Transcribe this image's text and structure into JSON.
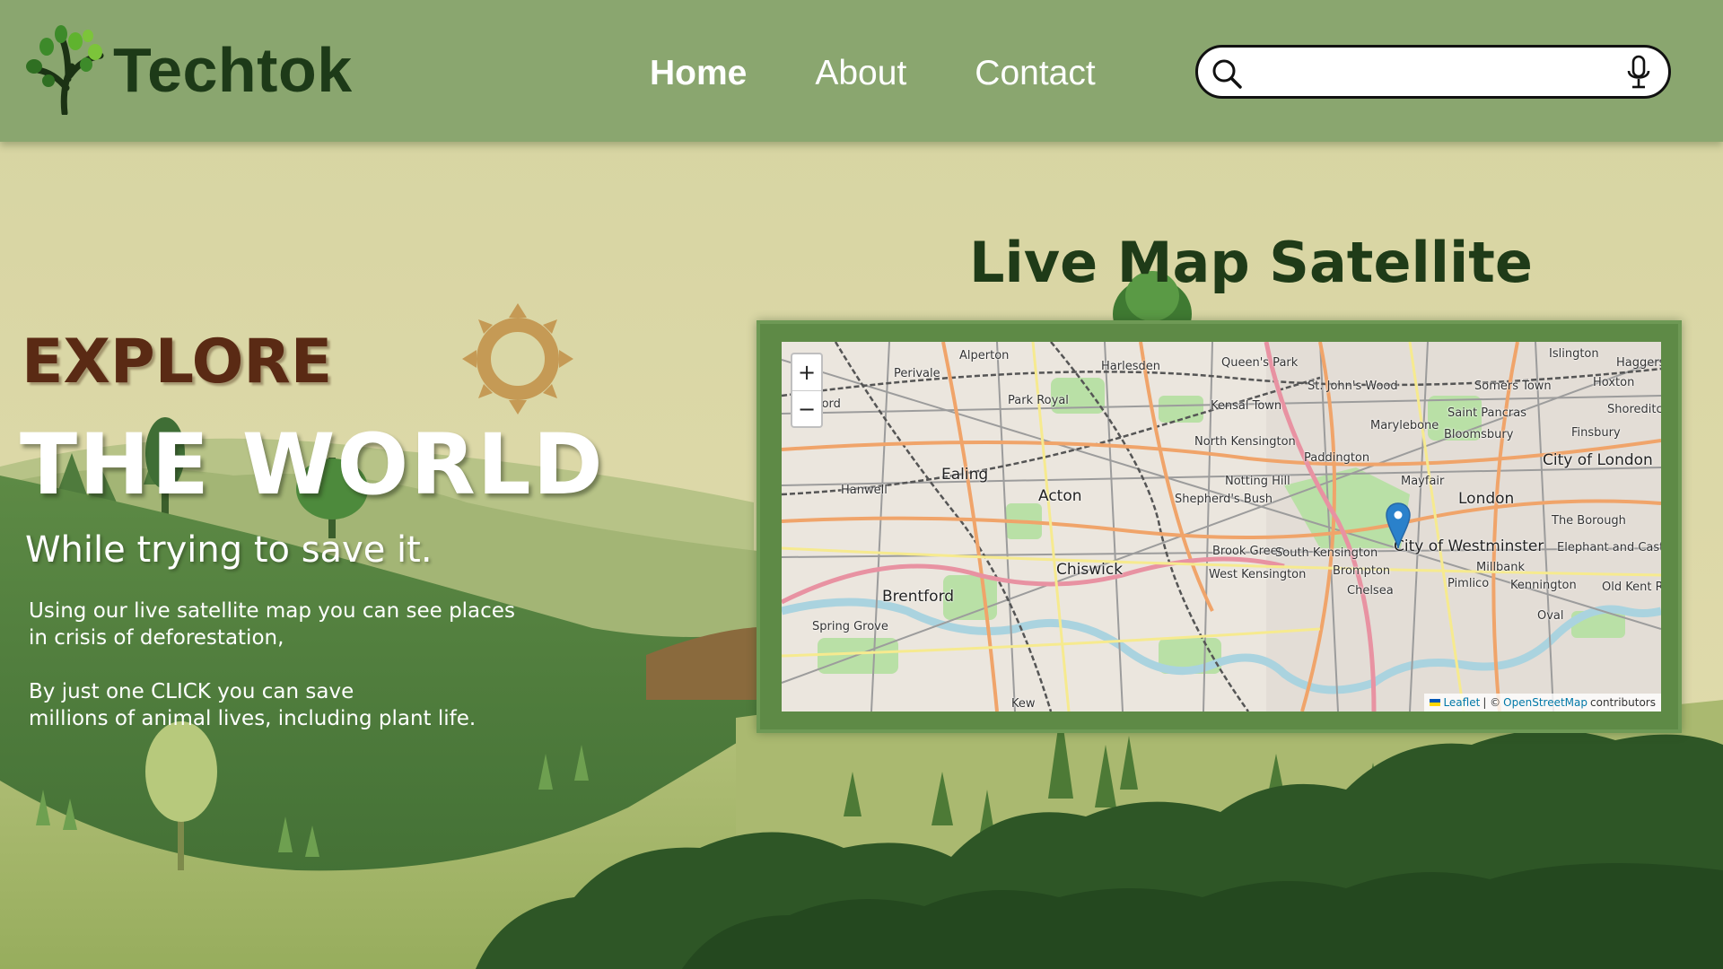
{
  "colors": {
    "header_bg": "#8aa66f",
    "brand_dark": "#1d3a18",
    "explore": "#5a2a14",
    "frame": "#5e8a46",
    "marker": "#2a81cb",
    "link": "#0078a8"
  },
  "header": {
    "logo_text": "Techtok",
    "logo_icon": "tree-icon",
    "nav": [
      {
        "label": "Home",
        "active": true
      },
      {
        "label": "About",
        "active": false
      },
      {
        "label": "Contact",
        "active": false
      }
    ],
    "search": {
      "value": "",
      "placeholder": "",
      "search_icon": "search-icon",
      "voice_icon": "microphone-icon"
    }
  },
  "hero": {
    "explore": "EXPLORE",
    "world": "THE WORLD",
    "tagline": "While trying to save it.",
    "para1_line1": "Using our live satellite map you can see places",
    "para1_line2": "in crisis of deforestation,",
    "para2_line1": "By just one CLICK you can save",
    "para2_line2": "millions of animal lives, including plant life."
  },
  "map_section": {
    "title": "Live Map Satellite",
    "zoom_in": "+",
    "zoom_out": "−",
    "attribution": {
      "leaflet": "Leaflet",
      "separator": "| ©",
      "osm": "OpenStreetMap",
      "suffix": "contributors"
    },
    "places": [
      "Alperton",
      "Harlesden",
      "Queen's Park",
      "Islington",
      "Haggerston",
      "Perivale",
      "St. John's Wood",
      "Somers Town",
      "Hoxton",
      "Park Royal",
      "Kensal Town",
      "Saint Pancras",
      "Shoreditch",
      "ford",
      "Marylebone",
      "Bloomsbury",
      "Finsbury",
      "North Kensington",
      "Paddington",
      "City of London",
      "Hanwell",
      "Ealing",
      "Notting Hill",
      "Mayfair",
      "Acton",
      "Shepherd's Bush",
      "London",
      "The Borough",
      "Brook Green",
      "South Kensington",
      "City of Westminster",
      "Elephant and Castle",
      "Chiswick",
      "West Kensington",
      "Brompton",
      "Millbank",
      "Brentford",
      "Chelsea",
      "Pimlico",
      "Kennington",
      "Old Kent Ro",
      "Spring Grove",
      "Kew",
      "Oval"
    ]
  }
}
